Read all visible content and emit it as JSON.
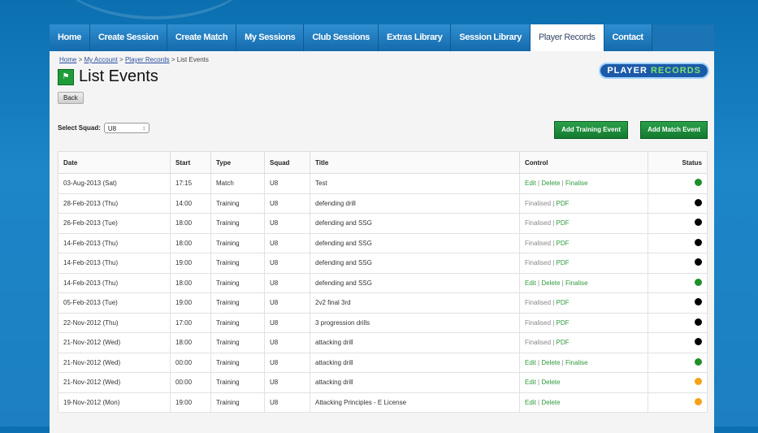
{
  "nav": [
    {
      "label": "Home",
      "active": false
    },
    {
      "label": "Create Session",
      "active": false
    },
    {
      "label": "Create Match",
      "active": false
    },
    {
      "label": "My Sessions",
      "active": false
    },
    {
      "label": "Club Sessions",
      "active": false
    },
    {
      "label": "Extras Library",
      "active": false
    },
    {
      "label": "Session Library",
      "active": false
    },
    {
      "label": "Player Records",
      "active": true
    },
    {
      "label": "Contact",
      "active": false
    }
  ],
  "breadcrumb": {
    "home": "Home",
    "sep1": " > ",
    "account": "My Account",
    "sep2": " > ",
    "records": "Player Records",
    "current": " > List Events"
  },
  "page_title": "List Events",
  "back_label": "Back",
  "logo": {
    "part1": "PLAYER ",
    "part2": "RECORDS"
  },
  "squad": {
    "label": "Select Squad:",
    "value": "U8"
  },
  "buttons": {
    "add_training": "Add Training Event",
    "add_match": "Add Match Event"
  },
  "columns": [
    "Date",
    "Start",
    "Type",
    "Squad",
    "Title",
    "Control",
    "Status"
  ],
  "colors": {
    "green": "#1f8f2a",
    "black": "#000000",
    "orange": "#f3a317"
  },
  "rows": [
    {
      "date": "03-Aug-2013 (Sat)",
      "start": "17:15",
      "type": "Match",
      "squad": "U8",
      "title": "Test",
      "control": [
        {
          "text": "Edit",
          "link": true
        },
        {
          "text": " | ",
          "link": false
        },
        {
          "text": "Delete",
          "link": true
        },
        {
          "text": " | ",
          "link": false
        },
        {
          "text": "Finalise",
          "link": true
        }
      ],
      "status": "green"
    },
    {
      "date": "28-Feb-2013 (Thu)",
      "start": "14:00",
      "type": "Training",
      "squad": "U8",
      "title": "defending drill",
      "control": [
        {
          "text": "Finalised | ",
          "link": false
        },
        {
          "text": "PDF",
          "link": true
        }
      ],
      "status": "black"
    },
    {
      "date": "26-Feb-2013 (Tue)",
      "start": "18:00",
      "type": "Training",
      "squad": "U8",
      "title": "defending and SSG",
      "control": [
        {
          "text": "Finalised | ",
          "link": false
        },
        {
          "text": "PDF",
          "link": true
        }
      ],
      "status": "black"
    },
    {
      "date": "14-Feb-2013 (Thu)",
      "start": "18:00",
      "type": "Training",
      "squad": "U8",
      "title": "defending and SSG",
      "control": [
        {
          "text": "Finalised | ",
          "link": false
        },
        {
          "text": "PDF",
          "link": true
        }
      ],
      "status": "black"
    },
    {
      "date": "14-Feb-2013 (Thu)",
      "start": "19:00",
      "type": "Training",
      "squad": "U8",
      "title": "defending and SSG",
      "control": [
        {
          "text": "Finalised | ",
          "link": false
        },
        {
          "text": "PDF",
          "link": true
        }
      ],
      "status": "black"
    },
    {
      "date": "14-Feb-2013 (Thu)",
      "start": "18:00",
      "type": "Training",
      "squad": "U8",
      "title": "defending and SSG",
      "control": [
        {
          "text": "Edit",
          "link": true
        },
        {
          "text": " | ",
          "link": false
        },
        {
          "text": "Delete",
          "link": true
        },
        {
          "text": " | ",
          "link": false
        },
        {
          "text": "Finalise",
          "link": true
        }
      ],
      "status": "green"
    },
    {
      "date": "05-Feb-2013 (Tue)",
      "start": "19:00",
      "type": "Training",
      "squad": "U8",
      "title": "2v2 final 3rd",
      "control": [
        {
          "text": "Finalised | ",
          "link": false
        },
        {
          "text": "PDF",
          "link": true
        }
      ],
      "status": "black"
    },
    {
      "date": "22-Nov-2012 (Thu)",
      "start": "17:00",
      "type": "Training",
      "squad": "U8",
      "title": "3 progression drills",
      "control": [
        {
          "text": "Finalised | ",
          "link": false
        },
        {
          "text": "PDF",
          "link": true
        }
      ],
      "status": "black"
    },
    {
      "date": "21-Nov-2012 (Wed)",
      "start": "18:00",
      "type": "Training",
      "squad": "U8",
      "title": "attacking drill",
      "control": [
        {
          "text": "Finalised | ",
          "link": false
        },
        {
          "text": "PDF",
          "link": true
        }
      ],
      "status": "black"
    },
    {
      "date": "21-Nov-2012 (Wed)",
      "start": "00:00",
      "type": "Training",
      "squad": "U8",
      "title": "attacking drill",
      "control": [
        {
          "text": "Edit",
          "link": true
        },
        {
          "text": " | ",
          "link": false
        },
        {
          "text": "Delete",
          "link": true
        },
        {
          "text": " | ",
          "link": false
        },
        {
          "text": "Finalise",
          "link": true
        }
      ],
      "status": "green"
    },
    {
      "date": "21-Nov-2012 (Wed)",
      "start": "00:00",
      "type": "Training",
      "squad": "U8",
      "title": "attacking drill",
      "control": [
        {
          "text": "Edit",
          "link": true
        },
        {
          "text": " | ",
          "link": false
        },
        {
          "text": "Delete",
          "link": true
        }
      ],
      "status": "orange"
    },
    {
      "date": "19-Nov-2012 (Mon)",
      "start": "19:00",
      "type": "Training",
      "squad": "U8",
      "title": "Attacking Principles - E License",
      "control": [
        {
          "text": "Edit",
          "link": true
        },
        {
          "text": " | ",
          "link": false
        },
        {
          "text": "Delete",
          "link": true
        }
      ],
      "status": "orange"
    }
  ]
}
